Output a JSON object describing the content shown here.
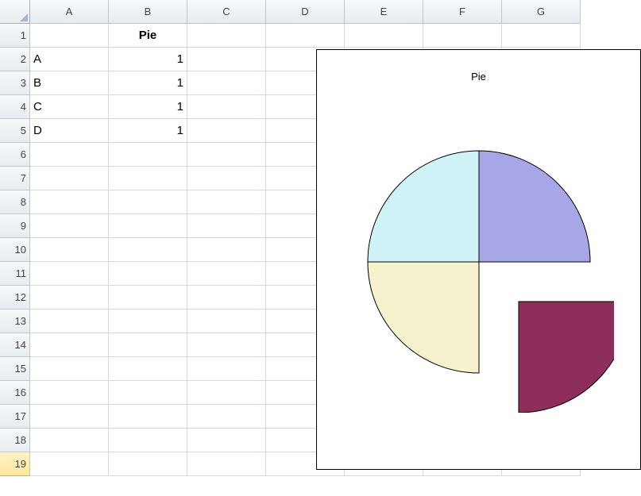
{
  "columns": [
    "A",
    "B",
    "C",
    "D",
    "E",
    "F",
    "G"
  ],
  "rows": [
    1,
    2,
    3,
    4,
    5,
    6,
    7,
    8,
    9,
    10,
    11,
    12,
    13,
    14,
    15,
    16,
    17,
    18,
    19
  ],
  "selected_row": 19,
  "cells": {
    "B1": "Pie",
    "A2": "A",
    "B2": "1",
    "A3": "B",
    "B3": "1",
    "A4": "C",
    "B4": "1",
    "A5": "D",
    "B5": "1"
  },
  "chart_data": {
    "type": "pie",
    "title": "Pie",
    "categories": [
      "A",
      "B",
      "C",
      "D"
    ],
    "values": [
      1,
      1,
      1,
      1
    ],
    "colors": {
      "A": "#A7A7E7",
      "B": "#8E2E5B",
      "C": "#F7F2CE",
      "D": "#CFF3F7"
    },
    "exploded": [
      "B"
    ]
  }
}
